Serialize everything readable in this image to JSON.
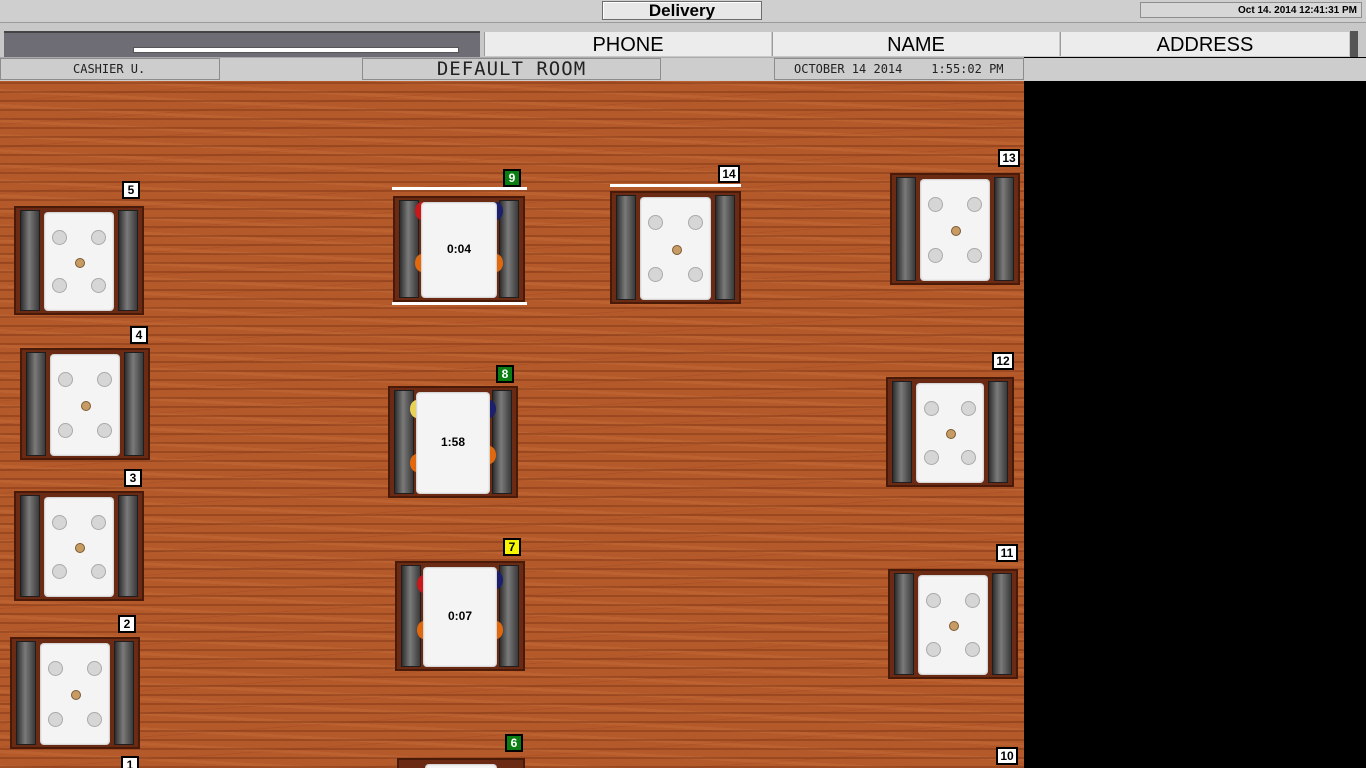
{
  "window": {
    "title": "Delivery",
    "clock": "Oct 14. 2014  12:41:31 PM"
  },
  "columns": [
    "PHONE",
    "NAME",
    "ADDRESS"
  ],
  "info": {
    "cashier": "CASHIER U.",
    "room": "DEFAULT ROOM",
    "date": "OCTOBER 14 2014",
    "time": "1:55:02 PM"
  },
  "colors": {
    "floor": "#b4592a",
    "status_green": "#0a7e12",
    "status_yellow": "#f6f600"
  },
  "tables": [
    {
      "number": "5",
      "status": "free",
      "timer": ""
    },
    {
      "number": "4",
      "status": "free",
      "timer": ""
    },
    {
      "number": "3",
      "status": "free",
      "timer": ""
    },
    {
      "number": "2",
      "status": "free",
      "timer": ""
    },
    {
      "number": "1",
      "status": "free",
      "timer": ""
    },
    {
      "number": "9",
      "status": "green",
      "timer": "0:04"
    },
    {
      "number": "8",
      "status": "green",
      "timer": "1:58"
    },
    {
      "number": "7",
      "status": "yellow",
      "timer": "0:07"
    },
    {
      "number": "6",
      "status": "green",
      "timer": ""
    },
    {
      "number": "14",
      "status": "free",
      "timer": ""
    },
    {
      "number": "13",
      "status": "free",
      "timer": ""
    },
    {
      "number": "12",
      "status": "free",
      "timer": ""
    },
    {
      "number": "11",
      "status": "free",
      "timer": ""
    },
    {
      "number": "10",
      "status": "free",
      "timer": ""
    }
  ]
}
